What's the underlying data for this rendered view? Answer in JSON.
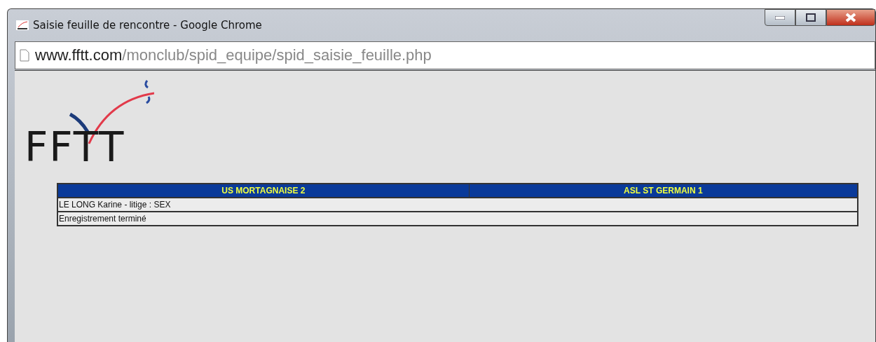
{
  "window": {
    "title": "Saisie feuille de rencontre - Google Chrome"
  },
  "address_bar": {
    "host": "www.fftt.com",
    "path": "/monclub/spid_equipe/spid_saisie_feuille.php"
  },
  "logo": {
    "text": "FFTT"
  },
  "table": {
    "columns": [
      "US MORTAGNAISE 2",
      "ASL ST GERMAIN 1"
    ],
    "rows": [
      "LE LONG Karine - litige : SEX",
      "Enregistrement terminé"
    ]
  }
}
